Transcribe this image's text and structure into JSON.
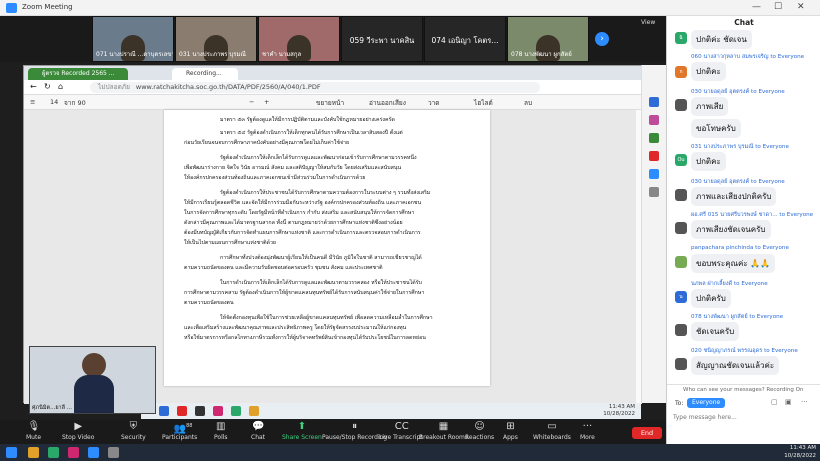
{
  "window": {
    "title": "Zoom Meeting",
    "view_label": "View"
  },
  "video_strip": [
    {
      "name": "071 นางปราณี ...ดาบุตรเลขานุการ",
      "type": "video"
    },
    {
      "name": "031 นางประภาพร บุรมณี",
      "type": "video"
    },
    {
      "name": "ชาคำ นามสกุล",
      "type": "video"
    },
    {
      "name": "059 วีระพา นาคสิน",
      "type": "name"
    },
    {
      "name": "074 เอนิญา โคตร...",
      "type": "name"
    },
    {
      "name": "078 นางพัฒนา ผูกสัตย์",
      "type": "video"
    }
  ],
  "browser": {
    "tabs": [
      "ผู้ตรวจ Recorded 2565 ...",
      "Recording..."
    ],
    "url": "www.ratchakitcha.soc.go.th/DATA/PDF/2560/A/040/1.PDF",
    "insecure_label": "ไม่ปลอดภัย",
    "pdf_toolbar": {
      "page": "14",
      "of": "จาก 90",
      "fit": "ขยายหน้า",
      "read": "อ่านออกเสียง",
      "draw": "วาด",
      "highlight": "ไฮไลต์",
      "erase": "ลบ"
    },
    "pdf_lines": [
      "มาตรา ๕๓ รัฐต้องดูแลให้มีการปฏิบัติตามและบังคับใช้กฎหมายอย่างเคร่งครัด",
      "มาตรา ๕๔ รัฐต้องดำเนินการให้เด็กทุกคนได้รับการศึกษาเป็นเวลาสิบสองปี ตั้งแต่",
      "ก่อนวัยเรียนจนจบการศึกษาภาคบังคับอย่างมีคุณภาพโดยไม่เก็บค่าใช้จ่าย",
      "รัฐต้องดำเนินการให้เด็กเล็กได้รับการดูแลและพัฒนาก่อนเข้ารับการศึกษาตามวรรคหนึ่ง",
      "เพื่อพัฒนาร่างกาย จิตใจ วินัย อารมณ์ สังคม และสติปัญญาให้สมกับวัย โดยส่งเสริมและสนับสนุน",
      "ให้องค์กรปกครองส่วนท้องถิ่นและภาคเอกชนเข้ามีส่วนร่วมในการดำเนินการด้วย",
      "รัฐต้องดำเนินการให้ประชาชนได้รับการศึกษาตามความต้องการในระบบต่าง ๆ รวมทั้งส่งเสริม",
      "ให้มีการเรียนรู้ตลอดชีวิต และจัดให้มีการร่วมมือกันระหว่างรัฐ องค์กรปกครองส่วนท้องถิ่น และภาคเอกชน",
      "ในการจัดการศึกษาทุกระดับ โดยรัฐมีหน้าที่ดำเนินการ กำกับ ส่งเสริม และสนับสนุนให้การจัดการศึกษา",
      "ดังกล่าวมีคุณภาพและได้มาตรฐานสากล ทั้งนี้ ตามกฎหมายว่าด้วยการศึกษาแห่งชาติซึ่งอย่างน้อย",
      "ต้องมีบทบัญญัติเกี่ยวกับการจัดทำแผนการศึกษาแห่งชาติ และการดำเนินการและตรวจสอบการดำเนินการ",
      "ให้เป็นไปตามแผนการศึกษาแห่งชาติด้วย",
      "การศึกษาทั้งปวงต้องมุ่งพัฒนาผู้เรียนให้เป็นคนดี มีวินัย ภูมิใจในชาติ สามารถเชี่ยวชาญได้",
      "ตามความถนัดของตน และมีความรับผิดชอบต่อครอบครัว ชุมชน สังคม และประเทศชาติ",
      "ในการดำเนินการให้เด็กเล็กได้รับการดูแลและพัฒนาตามวรรคสอง หรือให้ประชาชนได้รับ",
      "การศึกษาตามวรรคสาม รัฐต้องดำเนินการให้ผู้ขาดแคลนทุนทรัพย์ได้รับการสนับสนุนค่าใช้จ่ายในการศึกษา",
      "ตามความถนัดของตน",
      "ให้จัดตั้งกองทุนเพื่อใช้ในการช่วยเหลือผู้ขาดแคลนทุนทรัพย์ เพื่อลดความเหลื่อมล้ำในการศึกษา",
      "และเพื่อเสริมสร้างและพัฒนาคุณภาพและประสิทธิภาพครู โดยให้รัฐจัดสรรงบประมาณให้แก่กองทุน",
      "หรือใช้มาตรการหรือกลไกทางภาษีรวมทั้งการให้ผู้บริจาคทรัพย์สินเข้ากองทุนได้รับประโยชน์ในการลดหย่อน"
    ],
    "taskbar_time": "11:43 AM",
    "taskbar_date": "10/28/2022"
  },
  "self_view": {
    "name": "ศุภนิมิต...ยาลี ..."
  },
  "controls": [
    {
      "label": "Mute",
      "icon": "microphone-icon"
    },
    {
      "label": "Stop Video",
      "icon": "video-camera-icon"
    },
    {
      "label": "Security",
      "icon": "shield-icon"
    },
    {
      "label": "Participants",
      "icon": "participants-icon",
      "count": "88"
    },
    {
      "label": "Polls",
      "icon": "polls-icon"
    },
    {
      "label": "Chat",
      "icon": "chat-icon"
    },
    {
      "label": "Share Screen",
      "icon": "share-screen-icon"
    },
    {
      "label": "Pause/Stop Recording",
      "icon": "recording-icon"
    },
    {
      "label": "Live Transcript",
      "icon": "cc-icon"
    },
    {
      "label": "Breakout Rooms",
      "icon": "breakout-icon"
    },
    {
      "label": "Reactions",
      "icon": "smile-icon"
    },
    {
      "label": "Apps",
      "icon": "apps-icon"
    },
    {
      "label": "Whiteboards",
      "icon": "whiteboard-icon"
    },
    {
      "label": "More",
      "icon": "more-icon"
    }
  ],
  "end_label": "End",
  "chat": {
    "title": "Chat",
    "messages": [
      {
        "from": "",
        "text": "ปกติค่ะ ชัดเจน",
        "avatar": "ฉิ",
        "color": "#2aa86a"
      },
      {
        "from": "060 นางสาวกุหลาบ สมพรเจริญ to Everyone",
        "text": "ปกติคะ",
        "avatar": "ก",
        "color": "#e0772a"
      },
      {
        "from": "030 นายอดุลย์ อุตตรงค์ to Everyone",
        "text": "ภาพเสีย",
        "avatar": "",
        "color": "#555"
      },
      {
        "from": "",
        "text": "ขอโทษครับ",
        "avatar": "",
        "color": ""
      },
      {
        "from": "031 นางประภาพร บุรมณี to Everyone",
        "text": "ปกติคะ",
        "avatar": "Ou",
        "color": "#2aa86a"
      },
      {
        "from": "030 นายอดุลย์ อุตตรงค์ to Everyone",
        "text": "ภาพและเสียงปกติครับ",
        "avatar": "",
        "color": "#555"
      },
      {
        "from": "ผอ.ศรี 015 นายศรีบวรพงษ์ ชาดา... to Everyone",
        "text": "ภาพเสียงชัดเจนครับ",
        "avatar": "",
        "color": "#555"
      },
      {
        "from": "panpachara pinchinda to Everyone",
        "text": "ขอบพระคุณค่ะ 🙏🙏",
        "avatar": "",
        "color": "#7a5"
      },
      {
        "from": "นภพล ฝากเลี้ยงดี to Everyone",
        "text": "ปกติครับ",
        "avatar": "น",
        "color": "#2d6cd6"
      },
      {
        "from": "078 นางพัฒนา ผูกสัตย์ to Everyone",
        "text": "ชัดเจนครับ",
        "avatar": "",
        "color": "#555"
      },
      {
        "from": "020 ชนิญญาภรณ์ พรรณอุดร to Everyone",
        "text": "สัญญาณชัดเจนแล้วค่ะ",
        "avatar": "",
        "color": "#555"
      }
    ],
    "notice": "Who can see your messages? Recording On",
    "to_label": "To:",
    "recipient": "Everyone",
    "placeholder": "Type message here..."
  },
  "windows_time": "11:43 AM",
  "windows_date": "10/28/2022"
}
